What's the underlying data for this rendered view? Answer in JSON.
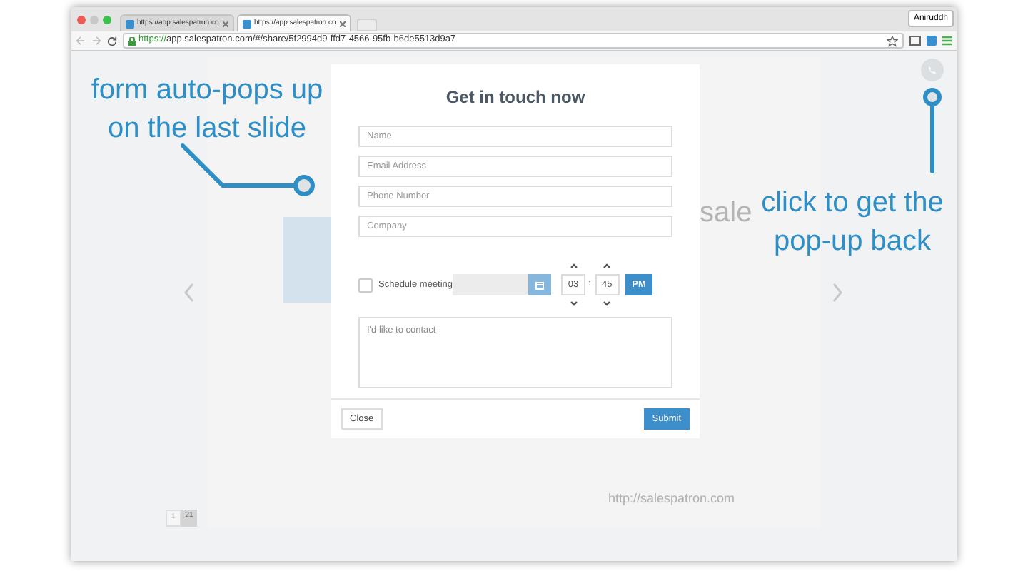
{
  "browser": {
    "tabs": [
      {
        "title": "https://app.salespatron.co",
        "selected": false
      },
      {
        "title": "https://app.salespatron.co",
        "selected": true
      }
    ],
    "profile": "Aniruddh",
    "url": {
      "scheme": "https://",
      "rest": "app.salespatron.com/#/share/5f2994d9-ffd7-4566-95fb-b6de5513d9a7"
    }
  },
  "slide": {
    "partial_word": "sale",
    "footer_url": "http://salespatron.com",
    "page_current": "1",
    "page_total": "21"
  },
  "dialog": {
    "title": "Get in touch now",
    "fields": [
      {
        "placeholder": "Name"
      },
      {
        "placeholder": "Email Address"
      },
      {
        "placeholder": "Phone Number"
      },
      {
        "placeholder": "Company"
      }
    ],
    "schedule": {
      "label": "Schedule meeting",
      "checked": false,
      "hour": "03",
      "separator": ":",
      "minute": "45",
      "period": "PM"
    },
    "message": {
      "placeholder": "I'd like to contact"
    },
    "close": "Close",
    "submit": "Submit"
  },
  "annotations": [
    {
      "text": "form auto-pops up on the last slide",
      "kind": "left-callout"
    },
    {
      "text": "click to get the pop-up back",
      "kind": "right-callout"
    }
  ]
}
